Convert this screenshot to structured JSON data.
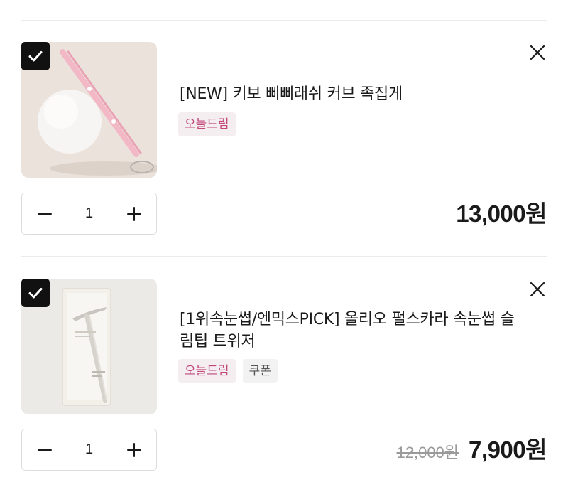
{
  "cart_items": [
    {
      "title": "[NEW] 키보 삐삐래쉬 커브 족집게",
      "badges": [
        "오늘드림"
      ],
      "quantity": "1",
      "price": "13,000원",
      "original_price": "",
      "checked": true
    },
    {
      "title": "[1위속눈썹/엔믹스PICK] 올리오 펄스카라 속눈썹 슬림팁 트위저",
      "badges": [
        "오늘드림",
        "쿠폰"
      ],
      "quantity": "1",
      "price": "7,900원",
      "original_price": "12,000원",
      "checked": true
    }
  ],
  "icons": {
    "checkbox": "check-icon",
    "remove": "close-icon",
    "decrease": "minus-icon",
    "increase": "plus-icon"
  },
  "colors": {
    "today_badge_bg": "#f4eef1",
    "today_badge_text": "#c2487a",
    "coupon_badge_bg": "#f2f2f2",
    "checkbox_bg": "#111111"
  }
}
